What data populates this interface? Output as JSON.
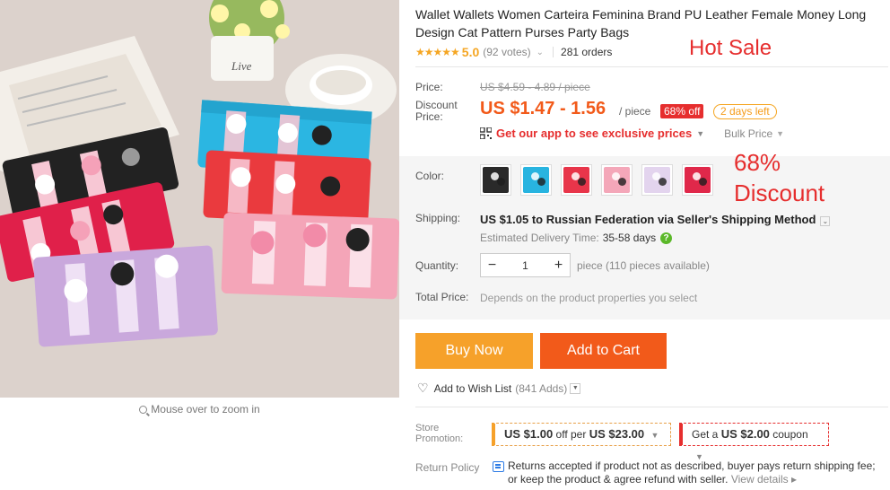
{
  "product": {
    "title": "Wallet Wallets Women Carteira Feminina Brand PU Leather Female Money Long Design Cat Pattern Purses Party Bags",
    "rating_stars": "★★★★★",
    "rating": "5.0",
    "votes": "(92 votes)",
    "orders": "281 orders"
  },
  "annotations": {
    "hot_sale": "Hot Sale",
    "discount_line1": "68%",
    "discount_line2": "Discount"
  },
  "price": {
    "label": "Price:",
    "original": "US $4.59 - 4.89 / piece",
    "discount_label_1": "Discount",
    "discount_label_2": "Price:",
    "current": "US $1.47 - 1.56",
    "unit": "/ piece",
    "off_badge": "68% off",
    "days_left": "2 days left",
    "app_promo": "Get our app to see exclusive prices",
    "bulk_price": "Bulk Price"
  },
  "options": {
    "color_label": "Color:",
    "colors": [
      {
        "name": "black",
        "hex": "#2a2a2a"
      },
      {
        "name": "blue",
        "hex": "#28b4e0"
      },
      {
        "name": "red",
        "hex": "#e8354a"
      },
      {
        "name": "pink",
        "hex": "#f4a7b9"
      },
      {
        "name": "purple",
        "hex": "#d9c7e8"
      },
      {
        "name": "rose",
        "hex": "#e0284a"
      }
    ]
  },
  "shipping": {
    "label": "Shipping:",
    "text": "US $1.05 to Russian Federation via Seller's Shipping Method",
    "eta_label": "Estimated Delivery Time:",
    "eta_days": "35-58 days",
    "help_icon": "?"
  },
  "quantity": {
    "label": "Quantity:",
    "minus": "−",
    "value": "1",
    "plus": "+",
    "unit": "piece",
    "available": "(110 pieces available)"
  },
  "total": {
    "label": "Total Price:",
    "hint": "Depends on the product properties you select"
  },
  "actions": {
    "buy_now": "Buy Now",
    "add_to_cart": "Add to Cart",
    "wishlist": "Add to Wish List",
    "wishlist_count": "(841 Adds)"
  },
  "gallery": {
    "zoom_hint": "Mouse over to zoom in",
    "vase_text": "Live"
  },
  "promotion": {
    "label_1": "Store",
    "label_2": "Promotion:",
    "coupon1_amount": "US $1.00",
    "coupon1_mid": "off per",
    "coupon1_threshold": "US $23.00",
    "coupon2_pre": "Get a",
    "coupon2_amount": "US $2.00",
    "coupon2_post": "coupon"
  },
  "returns": {
    "label": "Return Policy",
    "text": "Returns accepted if product not as described, buyer pays return shipping fee; or keep the product & agree refund with seller.",
    "details": "View details ▸"
  },
  "colors": {
    "accent_red": "#e62e2e",
    "price_orange": "#f25a1a",
    "buy_now_orange": "#f6a12a"
  }
}
